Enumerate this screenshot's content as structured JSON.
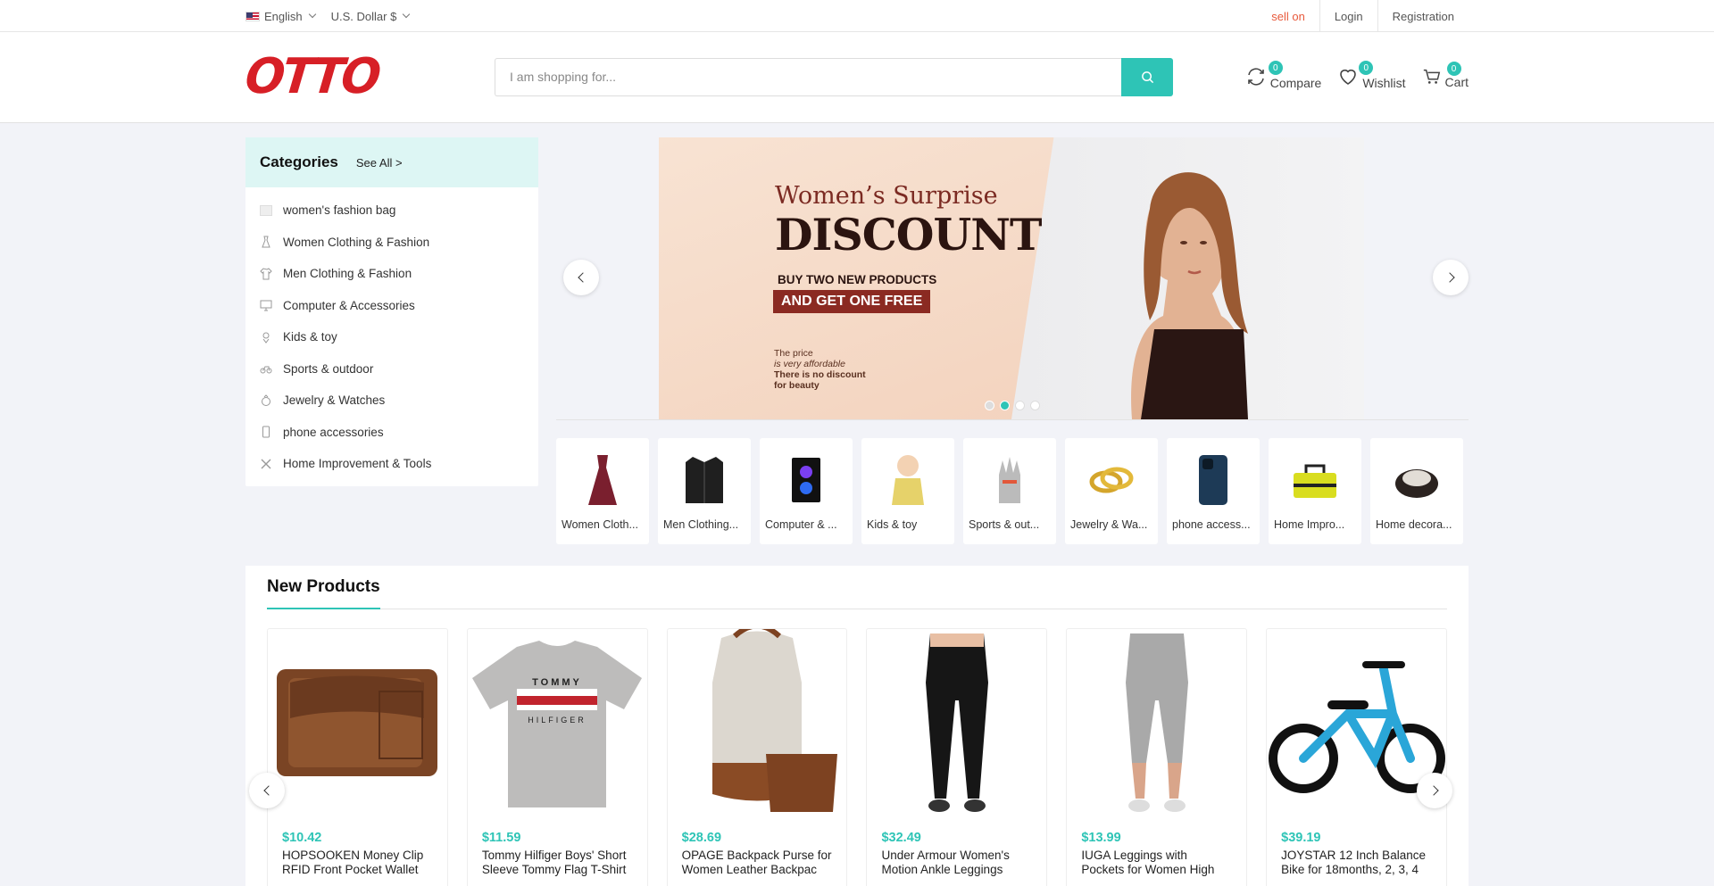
{
  "topbar": {
    "language": "English",
    "currency": "U.S. Dollar $",
    "sell_on": "sell on",
    "login": "Login",
    "registration": "Registration"
  },
  "header": {
    "logo": "OTTO",
    "search_placeholder": "I am shopping for...",
    "compare": {
      "label": "Compare",
      "count": "0"
    },
    "wishlist": {
      "label": "Wishlist",
      "count": "0"
    },
    "cart": {
      "label": "Cart",
      "count": "0"
    }
  },
  "categories": {
    "title": "Categories",
    "see_all": "See All >",
    "items": [
      {
        "label": "women's fashion bag",
        "icon": "image-placeholder-icon"
      },
      {
        "label": "Women Clothing & Fashion",
        "icon": "dress-icon"
      },
      {
        "label": "Men Clothing & Fashion",
        "icon": "shirt-icon"
      },
      {
        "label": "Computer & Accessories",
        "icon": "monitor-icon"
      },
      {
        "label": "Kids & toy",
        "icon": "toy-icon"
      },
      {
        "label": "Sports & outdoor",
        "icon": "bike-icon"
      },
      {
        "label": "Jewelry & Watches",
        "icon": "ring-icon"
      },
      {
        "label": "phone accessories",
        "icon": "phone-icon"
      },
      {
        "label": "Home Improvement & Tools",
        "icon": "tools-icon"
      }
    ]
  },
  "banner": {
    "line1": "Women’s Surprise",
    "line2": "DISCOUNT",
    "buy": "BUY TWO NEW PRODUCTS",
    "free": "AND GET ONE FREE",
    "small1": "The price",
    "small2": "is very affordable",
    "small3": "There is no discount",
    "small4": "for beauty",
    "active_slide": 2,
    "slide_count": 4
  },
  "mini_categories": [
    {
      "label": "Women Cloth...",
      "icon": "dress-icon"
    },
    {
      "label": "Men Clothing...",
      "icon": "jacket-icon"
    },
    {
      "label": "Computer & ...",
      "icon": "pc-tower-icon"
    },
    {
      "label": "Kids & toy",
      "icon": "baby-icon"
    },
    {
      "label": "Sports & out...",
      "icon": "glove-icon"
    },
    {
      "label": "Jewelry & Wa...",
      "icon": "rings-icon"
    },
    {
      "label": "phone access...",
      "icon": "phone-icon"
    },
    {
      "label": "Home Impro...",
      "icon": "toolbag-icon"
    },
    {
      "label": "Home decora...",
      "icon": "pouf-icon"
    }
  ],
  "new_products": {
    "title": "New Products",
    "items": [
      {
        "price": "$10.42",
        "title": "HOPSOOKEN Money Clip RFID Front Pocket Wallet",
        "icon": "wallet-icon"
      },
      {
        "price": "$11.59",
        "title": "Tommy Hilfiger Boys' Short Sleeve Tommy Flag T-Shirt",
        "icon": "tshirt-icon"
      },
      {
        "price": "$28.69",
        "title": "OPAGE Backpack Purse for Women Leather Backpac",
        "icon": "backpack-icon"
      },
      {
        "price": "$32.49",
        "title": "Under Armour Women's Motion Ankle Leggings",
        "icon": "leggings-icon"
      },
      {
        "price": "$13.99",
        "title": "IUGA Leggings with Pockets for Women High",
        "icon": "capri-icon"
      },
      {
        "price": "$39.19",
        "title": "JOYSTAR 12 Inch Balance Bike for 18months, 2, 3, 4",
        "icon": "balance-bike-icon"
      }
    ]
  },
  "colors": {
    "accent": "#2ec4b6",
    "brand": "#d71f26",
    "sell_on": "#e8593b"
  }
}
